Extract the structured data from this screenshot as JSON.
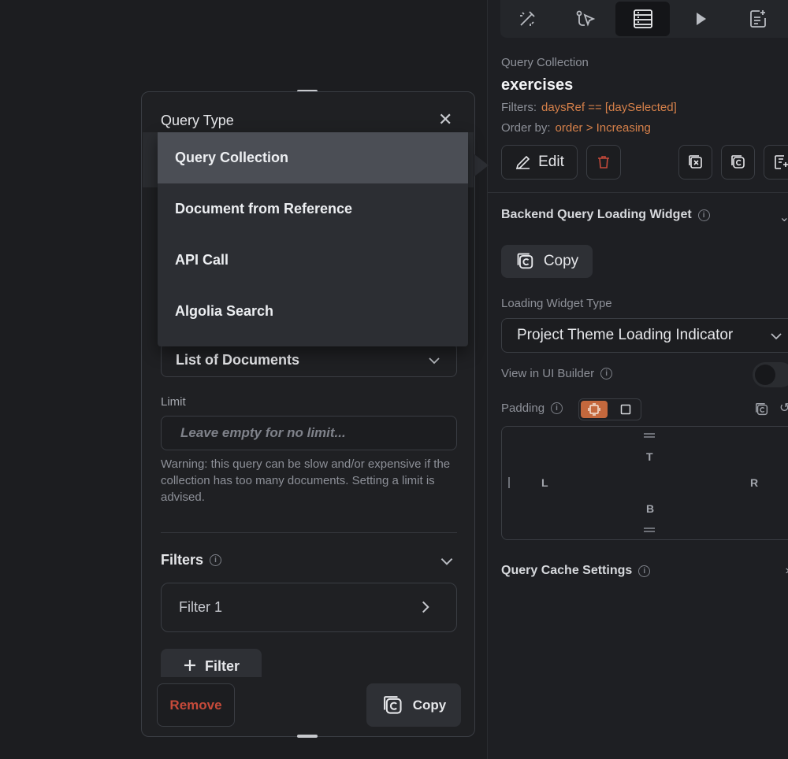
{
  "right_panel": {
    "tabs": [
      {
        "icon": "magic-wand-icon",
        "active": false
      },
      {
        "icon": "api-icon",
        "active": false
      },
      {
        "icon": "database-icon",
        "active": true
      },
      {
        "icon": "play-icon",
        "active": false
      },
      {
        "icon": "document-icon",
        "active": false
      }
    ],
    "query_collection_label": "Query Collection",
    "collection_name": "exercises",
    "filters_label": "Filters:",
    "filters_value": "daysRef == [daySelected]",
    "order_label": "Order by:",
    "order_value": "order > Increasing",
    "edit_label": "Edit",
    "backend_query_title": "Backend Query Loading Widget",
    "copy_label": "Copy",
    "loading_widget_type_label": "Loading Widget Type",
    "loading_widget_value": "Project Theme Loading Indicator",
    "view_in_ui_builder_label": "View in UI Builder",
    "padding_label": "Padding",
    "padding_sides": {
      "top": "T",
      "left": "L",
      "right": "R",
      "bottom": "B"
    },
    "query_cache_title": "Query Cache Settings",
    "colors": {
      "accent": "#d7814a",
      "danger": "#c64a3a",
      "padding_active": "#c4683d"
    }
  },
  "query_panel": {
    "title": "Query Type",
    "dropdown_items": [
      {
        "label": "Query Collection",
        "selected": true
      },
      {
        "label": "Document from Reference",
        "selected": false
      },
      {
        "label": "API Call",
        "selected": false
      },
      {
        "label": "Algolia Search",
        "selected": false
      }
    ],
    "return_type_value": "List of Documents",
    "limit_label": "Limit",
    "limit_placeholder": "Leave empty for no limit...",
    "warning_text": "Warning: this query can be slow and/or expensive if the collection has too many documents. Setting a limit is advised.",
    "filters_title": "Filters",
    "filter_items": [
      {
        "label": "Filter 1"
      }
    ],
    "add_filter_label": "Filter",
    "remove_label": "Remove",
    "copy_label": "Copy"
  }
}
